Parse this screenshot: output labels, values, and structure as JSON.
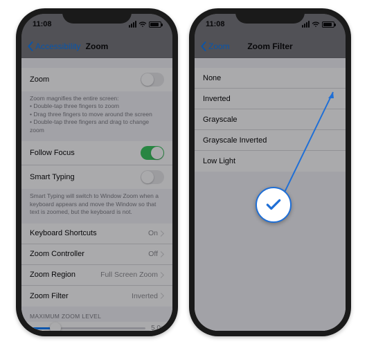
{
  "status": {
    "time": "11:08"
  },
  "phone1": {
    "nav": {
      "back": "Accessibility",
      "title": "Zoom"
    },
    "zoom_row": "Zoom",
    "zoom_footer": "Zoom magnifies the entire screen:\n• Double-tap three fingers to zoom\n• Drag three fingers to move around the screen\n• Double-tap three fingers and drag to change zoom",
    "follow_focus": "Follow Focus",
    "smart_typing": "Smart Typing",
    "smart_footer": "Smart Typing will switch to Window Zoom when a keyboard appears and move the Window so that text is zoomed, but the keyboard is not.",
    "keyboard_shortcuts": {
      "label": "Keyboard Shortcuts",
      "value": "On"
    },
    "zoom_controller": {
      "label": "Zoom Controller",
      "value": "Off"
    },
    "zoom_region": {
      "label": "Zoom Region",
      "value": "Full Screen Zoom"
    },
    "zoom_filter": {
      "label": "Zoom Filter",
      "value": "Inverted"
    },
    "max_header": "MAXIMUM ZOOM LEVEL",
    "max_value": "5.0x"
  },
  "phone2": {
    "nav": {
      "back": "Zoom",
      "title": "Zoom Filter"
    },
    "options": {
      "none": "None",
      "inverted": "Inverted",
      "grayscale": "Grayscale",
      "grayscale_inverted": "Grayscale Inverted",
      "low_light": "Low Light"
    }
  }
}
